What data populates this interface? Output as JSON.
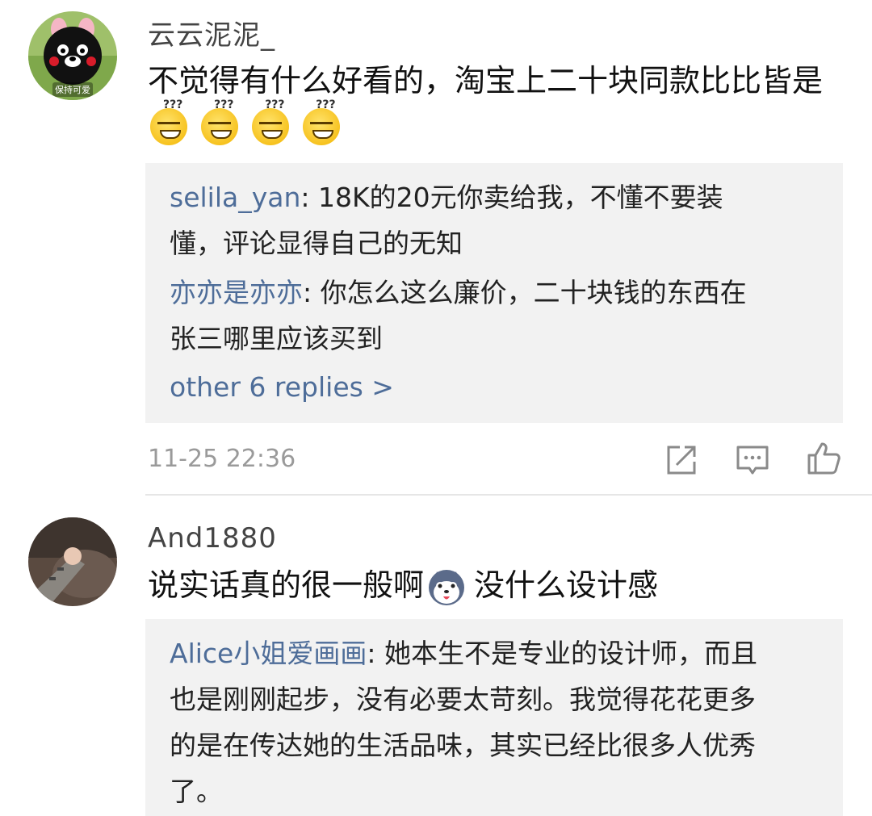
{
  "comments": [
    {
      "username": "云云泥泥_",
      "avatar_caption": "保持可爱",
      "text": "不觉得有什么好看的，淘宝上二十块同款比比皆是",
      "emoji_icons": [
        "dizzy-smile-emoji",
        "dizzy-smile-emoji",
        "dizzy-smile-emoji",
        "dizzy-smile-emoji"
      ],
      "replies": [
        {
          "name": "selila_yan",
          "sep": ": ",
          "text_line1": "18K的20元你卖给我，不懂不要装",
          "text_line2": "懂，评论显得自己的无知"
        },
        {
          "name": "亦亦是亦亦",
          "sep": ": ",
          "text_line1": "你怎么这么廉价，二十块钱的东西在",
          "text_line2": "张三哪里应该买到"
        }
      ],
      "more_replies": "other 6 replies >",
      "timestamp": "11-25 22:36",
      "actions": [
        "share-icon",
        "comment-icon",
        "like-icon"
      ]
    },
    {
      "username": "And1880",
      "text_before_emoji": "说实话真的很一般啊",
      "text_after_emoji": "没什么设计感",
      "emoji_icon": "husky-face-emoji",
      "replies": [
        {
          "name": "Alice小姐爱画画",
          "sep": ": ",
          "text_line1": "她本生不是专业的设计师，而且",
          "text_line2": "也是刚刚起步，没有必要太苛刻。我觉得花花更多",
          "text_line3": "的是在传达她的生活品味，其实已经比很多人优秀",
          "text_line4": "了。"
        }
      ]
    }
  ]
}
